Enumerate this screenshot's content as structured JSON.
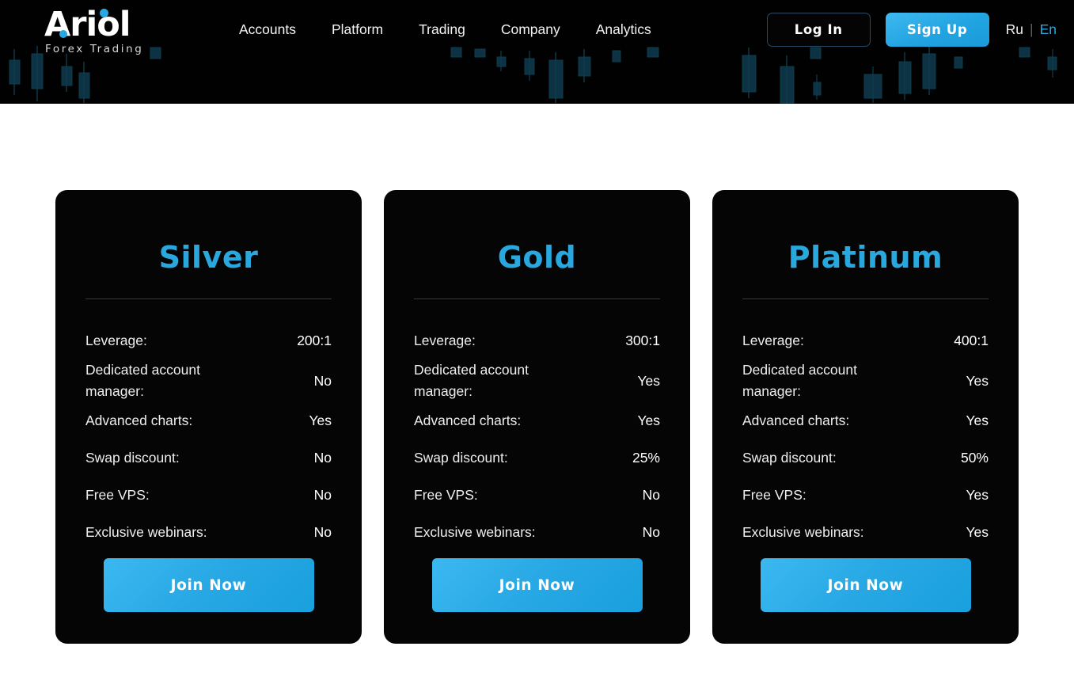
{
  "brand": {
    "name": "Ariol",
    "tagline": "Forex Trading",
    "accent_color": "#29a8e0",
    "logo_dot_icon": "blue-dot-icon"
  },
  "header": {
    "background_color": "#010101",
    "nav": [
      {
        "label": "Accounts"
      },
      {
        "label": "Platform"
      },
      {
        "label": "Trading"
      },
      {
        "label": "Company"
      },
      {
        "label": "Analytics"
      }
    ],
    "auth": {
      "login_label": "Log In",
      "signup_label": "Sign Up"
    },
    "language": {
      "inactive": "Ru",
      "separator": "|",
      "active": "En"
    },
    "decor": {
      "candlestick_color": "#0d3444",
      "candlestick_wick_color": "#10414f"
    }
  },
  "plans": [
    {
      "title": "Silver",
      "features": [
        {
          "label": "Leverage:",
          "value": "200:1"
        },
        {
          "label": "Dedicated account manager:",
          "value": "No"
        },
        {
          "label": "Advanced charts:",
          "value": "Yes"
        },
        {
          "label": "Swap discount:",
          "value": "No"
        },
        {
          "label": "Free VPS:",
          "value": "No"
        },
        {
          "label": "Exclusive webinars:",
          "value": "No"
        }
      ],
      "cta_label": "Join Now"
    },
    {
      "title": "Gold",
      "features": [
        {
          "label": "Leverage:",
          "value": "300:1"
        },
        {
          "label": "Dedicated account manager:",
          "value": "Yes"
        },
        {
          "label": "Advanced charts:",
          "value": "Yes"
        },
        {
          "label": "Swap discount:",
          "value": "25%"
        },
        {
          "label": "Free VPS:",
          "value": "No"
        },
        {
          "label": "Exclusive webinars:",
          "value": "No"
        }
      ],
      "cta_label": "Join Now"
    },
    {
      "title": "Platinum",
      "features": [
        {
          "label": "Leverage:",
          "value": "400:1"
        },
        {
          "label": "Dedicated account manager:",
          "value": "Yes"
        },
        {
          "label": "Advanced charts:",
          "value": "Yes"
        },
        {
          "label": "Swap discount:",
          "value": "50%"
        },
        {
          "label": "Free VPS:",
          "value": "Yes"
        },
        {
          "label": "Exclusive webinars:",
          "value": "Yes"
        }
      ],
      "cta_label": "Join Now"
    }
  ]
}
